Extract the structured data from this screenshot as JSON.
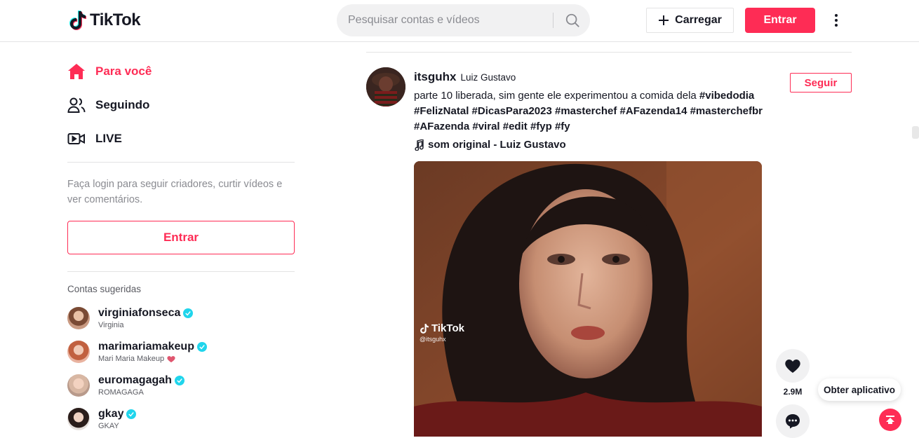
{
  "header": {
    "logo_text": "TikTok",
    "search_placeholder": "Pesquisar contas e vídeos",
    "upload_label": "Carregar",
    "login_label": "Entrar"
  },
  "sidebar": {
    "nav": [
      {
        "label": "Para você",
        "icon": "home-icon",
        "active": true
      },
      {
        "label": "Seguindo",
        "icon": "following-icon",
        "active": false
      },
      {
        "label": "LIVE",
        "icon": "live-icon",
        "active": false
      }
    ],
    "login_hint": "Faça login para seguir criadores, curtir vídeos e ver comentários.",
    "login_button": "Entrar",
    "suggested_title": "Contas sugeridas",
    "accounts": [
      {
        "username": "virginiafonseca",
        "name": "Virginia",
        "verified": true
      },
      {
        "username": "marimariamakeup",
        "name": "Mari Maria Makeup",
        "verified": true,
        "emoji": "heart-icon"
      },
      {
        "username": "euromagagah",
        "name": "ROMAGAGA",
        "verified": true
      },
      {
        "username": "gkay",
        "name": "GKAY",
        "verified": true
      }
    ]
  },
  "post": {
    "username": "itsguhx",
    "nickname": "Luiz Gustavo",
    "follow_label": "Seguir",
    "caption_text": "parte 10 liberada, sim gente ele experimentou a comida dela ",
    "hashtags": [
      "#vibedodia",
      "#FelizNatal",
      "#DicasPara2023",
      "#masterchef",
      "#AFazenda14",
      "#masterchefbr",
      "#AFazenda",
      "#viral",
      "#edit",
      "#fyp",
      "#fy"
    ],
    "music": "som original - Luiz Gustavo",
    "watermark_logo": "TikTok",
    "watermark_handle": "@itsguhx",
    "like_count": "2.9M"
  },
  "floating": {
    "get_app": "Obter aplicativo"
  },
  "colors": {
    "brand": "#fe2c55",
    "text": "#161823",
    "muted": "#8a8b91",
    "verified": "#20d5ec"
  }
}
